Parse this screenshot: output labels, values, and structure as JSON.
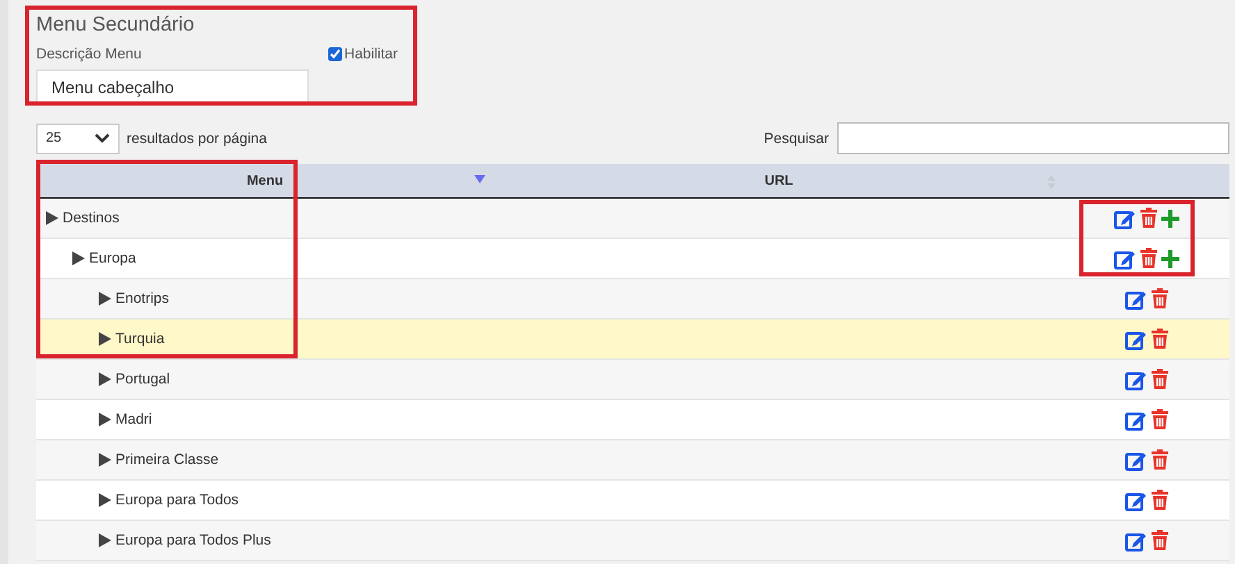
{
  "form": {
    "title": "Menu Secundário",
    "description_label": "Descrição Menu",
    "description_value": "Menu cabeçalho",
    "enable": {
      "label": "Habilitar",
      "checked": true
    }
  },
  "length": {
    "value": "25",
    "label": "resultados por página"
  },
  "search": {
    "label": "Pesquisar"
  },
  "table": {
    "columns": [
      {
        "label": "Menu",
        "sorted": true
      },
      {
        "label": "URL",
        "sorted": false
      }
    ],
    "rows": [
      {
        "label": "Destinos",
        "expanded": false,
        "selected": false,
        "can_add": true,
        "children": [
          {
            "label": "Europa",
            "expanded": false,
            "selected": false,
            "can_add": true,
            "children": [
              {
                "label": "Enotrips",
                "expanded": false,
                "selected": false,
                "can_add": false
              },
              {
                "label": "Turquia",
                "expanded": false,
                "selected": true,
                "can_add": false
              },
              {
                "label": "Portugal",
                "expanded": false,
                "selected": false,
                "can_add": false
              },
              {
                "label": "Madri",
                "expanded": false,
                "selected": false,
                "can_add": false
              },
              {
                "label": "Primeira Classe",
                "expanded": false,
                "selected": false,
                "can_add": false
              },
              {
                "label": "Europa para Todos",
                "expanded": false,
                "selected": false,
                "can_add": false
              },
              {
                "label": "Europa para Todos Plus",
                "expanded": false,
                "selected": false,
                "can_add": false
              }
            ]
          }
        ]
      }
    ]
  },
  "highlights": [
    {
      "kind": "form"
    },
    {
      "kind": "menu_column"
    },
    {
      "kind": "actions"
    }
  ]
}
